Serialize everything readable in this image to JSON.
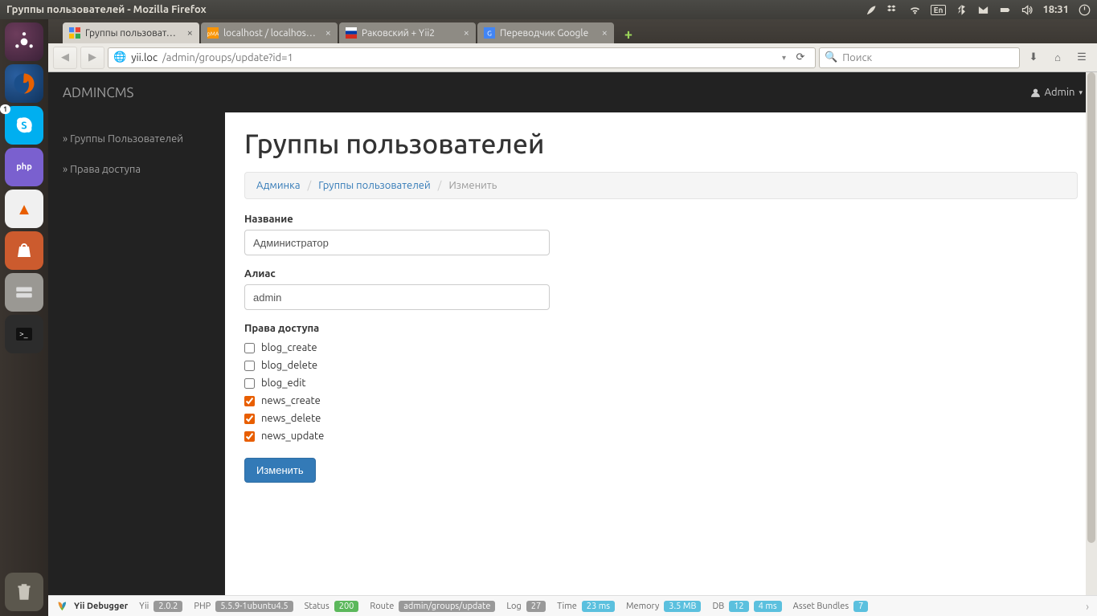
{
  "menubar": {
    "title": "Группы пользователей - Mozilla Firefox",
    "lang": "En",
    "time": "18:31"
  },
  "launcher": {
    "skype_badge": "1",
    "php_label": "php",
    "vlc_glyph": "▲"
  },
  "tabs": [
    {
      "label": "Группы пользоват…",
      "active": true
    },
    {
      "label": "localhost / localhos…",
      "active": false
    },
    {
      "label": "Раковский + Yii2",
      "active": false
    },
    {
      "label": "Переводчик Google",
      "active": false
    }
  ],
  "url": {
    "host": "yii.loc",
    "path": "/admin/groups/update?id=1"
  },
  "search_placeholder": "Поиск",
  "app": {
    "brand": "ADMINCMS",
    "user": "Admin",
    "sidebar": [
      "» Группы Пользователей",
      "» Права доступа"
    ],
    "title": "Группы пользователей",
    "breadcrumb": {
      "admin": "Админка",
      "groups": "Группы пользователей",
      "current": "Изменить"
    },
    "form": {
      "name_label": "Название",
      "name_value": "Администратор",
      "alias_label": "Алиас",
      "alias_value": "admin",
      "perm_label": "Права доступа",
      "perms": [
        {
          "label": "blog_create",
          "checked": false
        },
        {
          "label": "blog_delete",
          "checked": false
        },
        {
          "label": "blog_edit",
          "checked": false
        },
        {
          "label": "news_create",
          "checked": true
        },
        {
          "label": "news_delete",
          "checked": true
        },
        {
          "label": "news_update",
          "checked": true
        }
      ],
      "submit": "Изменить"
    }
  },
  "yii": {
    "debugger": "Yii Debugger",
    "yii_label": "Yii",
    "yii_ver": "2.0.2",
    "php_label": "PHP",
    "php_ver": "5.5.9-1ubuntu4.5",
    "status_label": "Status",
    "status": "200",
    "route_label": "Route",
    "route": "admin/groups/update",
    "log_label": "Log",
    "log": "27",
    "time_label": "Time",
    "time": "23 ms",
    "mem_label": "Memory",
    "mem": "3.5 MB",
    "db_label": "DB",
    "db_n": "12",
    "db_t": "4 ms",
    "asset_label": "Asset Bundles",
    "asset": "7"
  }
}
